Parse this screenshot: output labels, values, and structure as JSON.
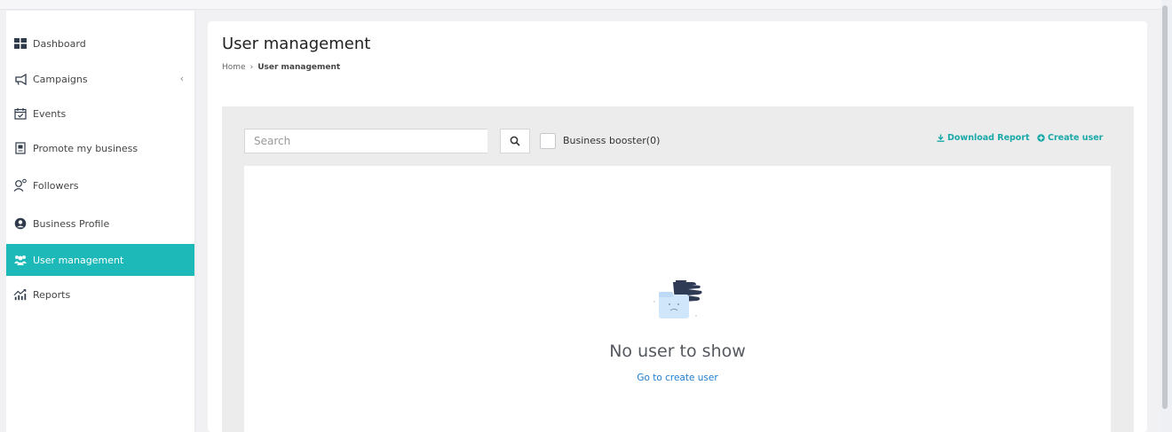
{
  "sidebar": {
    "items": [
      {
        "label": "Dashboard",
        "icon": "dashboard-grid-icon"
      },
      {
        "label": "Campaigns",
        "icon": "megaphone-icon"
      },
      {
        "label": "Events",
        "icon": "calendar-check-icon"
      },
      {
        "label": "Promote my business",
        "icon": "document-icon"
      },
      {
        "label": "Followers",
        "icon": "followers-icon"
      },
      {
        "label": "Business Profile",
        "icon": "profile-circle-icon"
      },
      {
        "label": "User management",
        "icon": "users-icon",
        "active": true
      },
      {
        "label": "Reports",
        "icon": "reports-chart-icon"
      }
    ],
    "campaigns_chevron": "‹"
  },
  "header": {
    "title": "User management",
    "breadcrumb": {
      "home": "Home",
      "separator": "›",
      "current": "User management"
    }
  },
  "toolbar": {
    "search_placeholder": "Search",
    "business_booster_label": "Business booster(0)",
    "download_report_label": "Download Report",
    "create_user_label": "Create user"
  },
  "empty_state": {
    "title": "No user to show",
    "link": "Go to create user"
  },
  "colors": {
    "accent": "#1db9b8",
    "link_teal": "#1aa9a8",
    "link_blue": "#1f7ccf",
    "panel_gray": "#ececed"
  }
}
